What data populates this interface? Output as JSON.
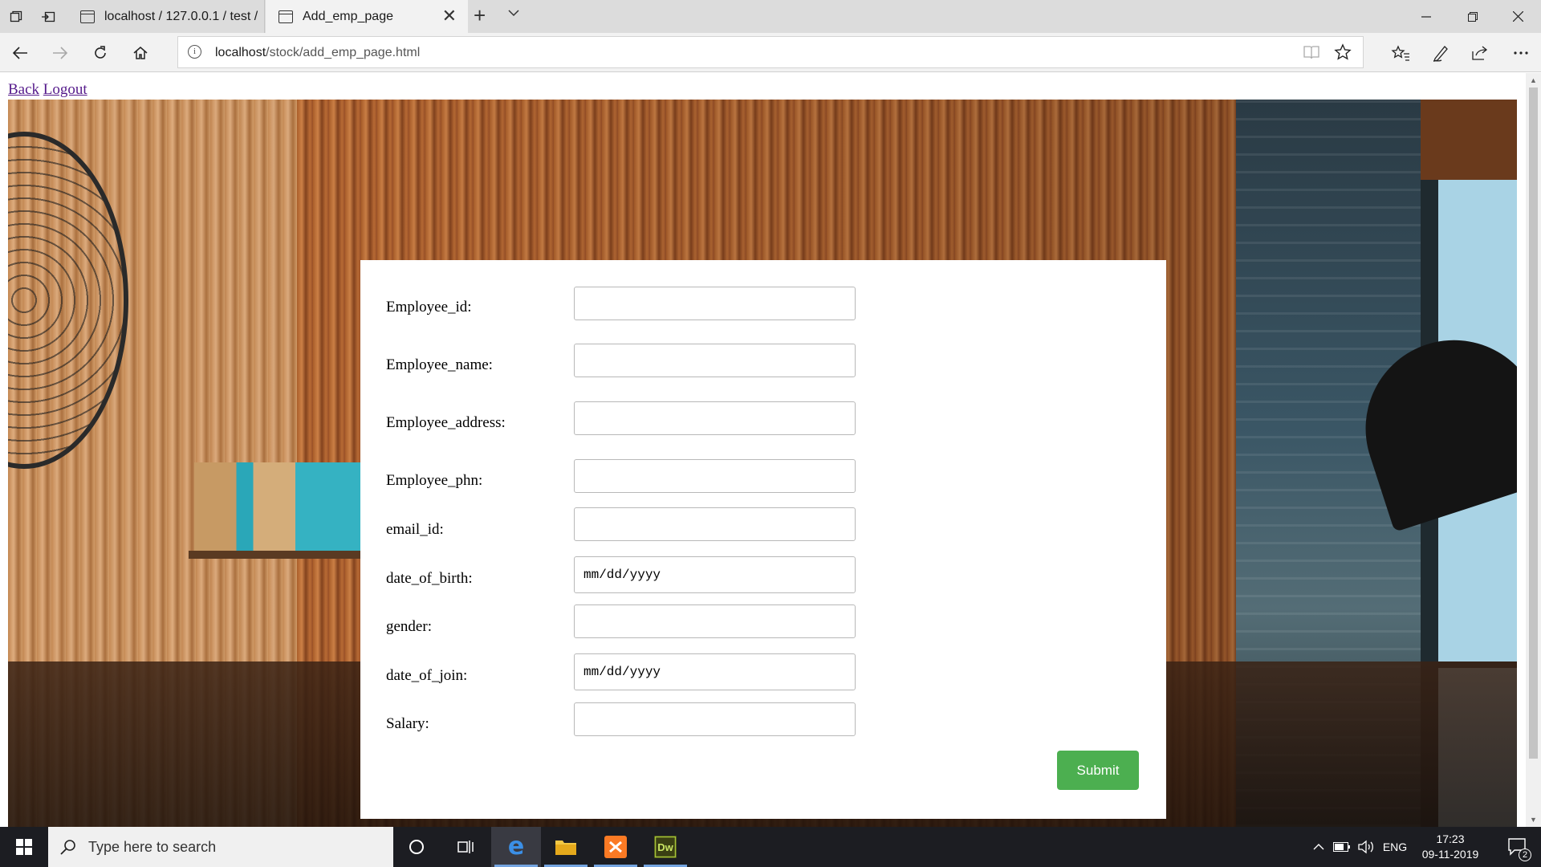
{
  "browser": {
    "tabs": [
      {
        "title": "localhost / 127.0.0.1 / test /",
        "active": false
      },
      {
        "title": "Add_emp_page",
        "active": true
      }
    ],
    "address": {
      "host": "localhost",
      "path": "/stock/add_emp_page.html"
    }
  },
  "page": {
    "links": {
      "back": "Back",
      "logout": "Logout"
    },
    "form": {
      "fields": [
        {
          "label": "Employee_id:",
          "value": "",
          "type": "text"
        },
        {
          "label": "Employee_name:",
          "value": "",
          "type": "text"
        },
        {
          "label": "Employee_address:",
          "value": "",
          "type": "text"
        },
        {
          "label": "Employee_phn:",
          "value": "",
          "type": "text"
        },
        {
          "label": "email_id:",
          "value": "",
          "type": "text"
        },
        {
          "label": "date_of_birth:",
          "value": "mm/dd/yyyy",
          "type": "date"
        },
        {
          "label": "gender:",
          "value": "",
          "type": "text"
        },
        {
          "label": "date_of_join:",
          "value": "mm/dd/yyyy",
          "type": "date"
        },
        {
          "label": "Salary:",
          "value": "",
          "type": "text"
        }
      ],
      "submit_label": "Submit",
      "submit_color": "#4caf50"
    }
  },
  "taskbar": {
    "search_placeholder": "Type here to search",
    "apps": [
      "task-view",
      "microsoft-edge",
      "file-explorer",
      "xampp",
      "dreamweaver"
    ],
    "tray": {
      "language": "ENG",
      "time": "17:23",
      "date": "09-11-2019",
      "notification_count": "2"
    }
  }
}
